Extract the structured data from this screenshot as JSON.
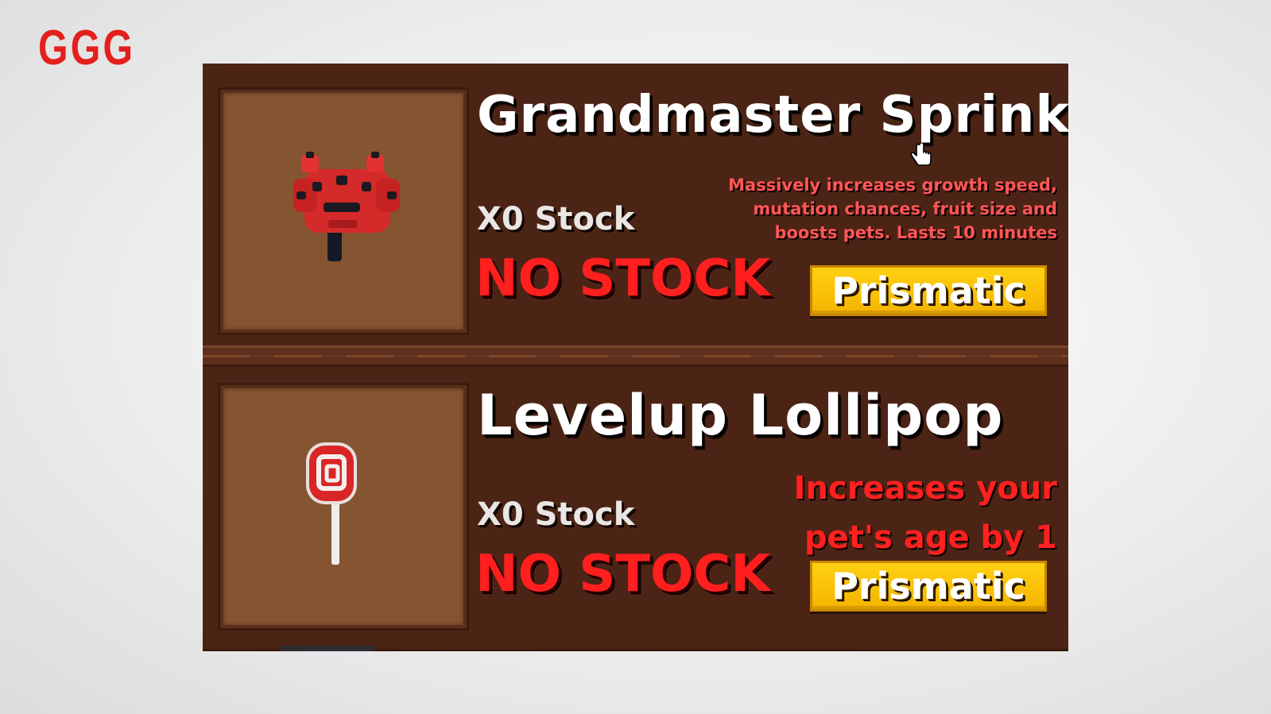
{
  "logo": {
    "text": "GGG"
  },
  "items": [
    {
      "name": "Grandmaster Sprinkler",
      "stock": "X0 Stock",
      "status": "NO STOCK",
      "description_lines": [
        "Massively increases growth speed,",
        "mutation chances, fruit size and",
        "boosts pets. Lasts 10 minutes"
      ],
      "rarity": "Prismatic",
      "icon": "sprinkler-icon"
    },
    {
      "name": "Levelup Lollipop",
      "stock": "X0 Stock",
      "status": "NO STOCK",
      "description_lines": [
        "Increases your",
        "pet's age by 1"
      ],
      "rarity": "Prismatic",
      "icon": "lollipop-icon"
    }
  ],
  "colors": {
    "panel": "#4c2416",
    "slot": "#855431",
    "status": "#ff1f1f",
    "rarity_button": "#f4b400",
    "logo": "#e3201c"
  }
}
